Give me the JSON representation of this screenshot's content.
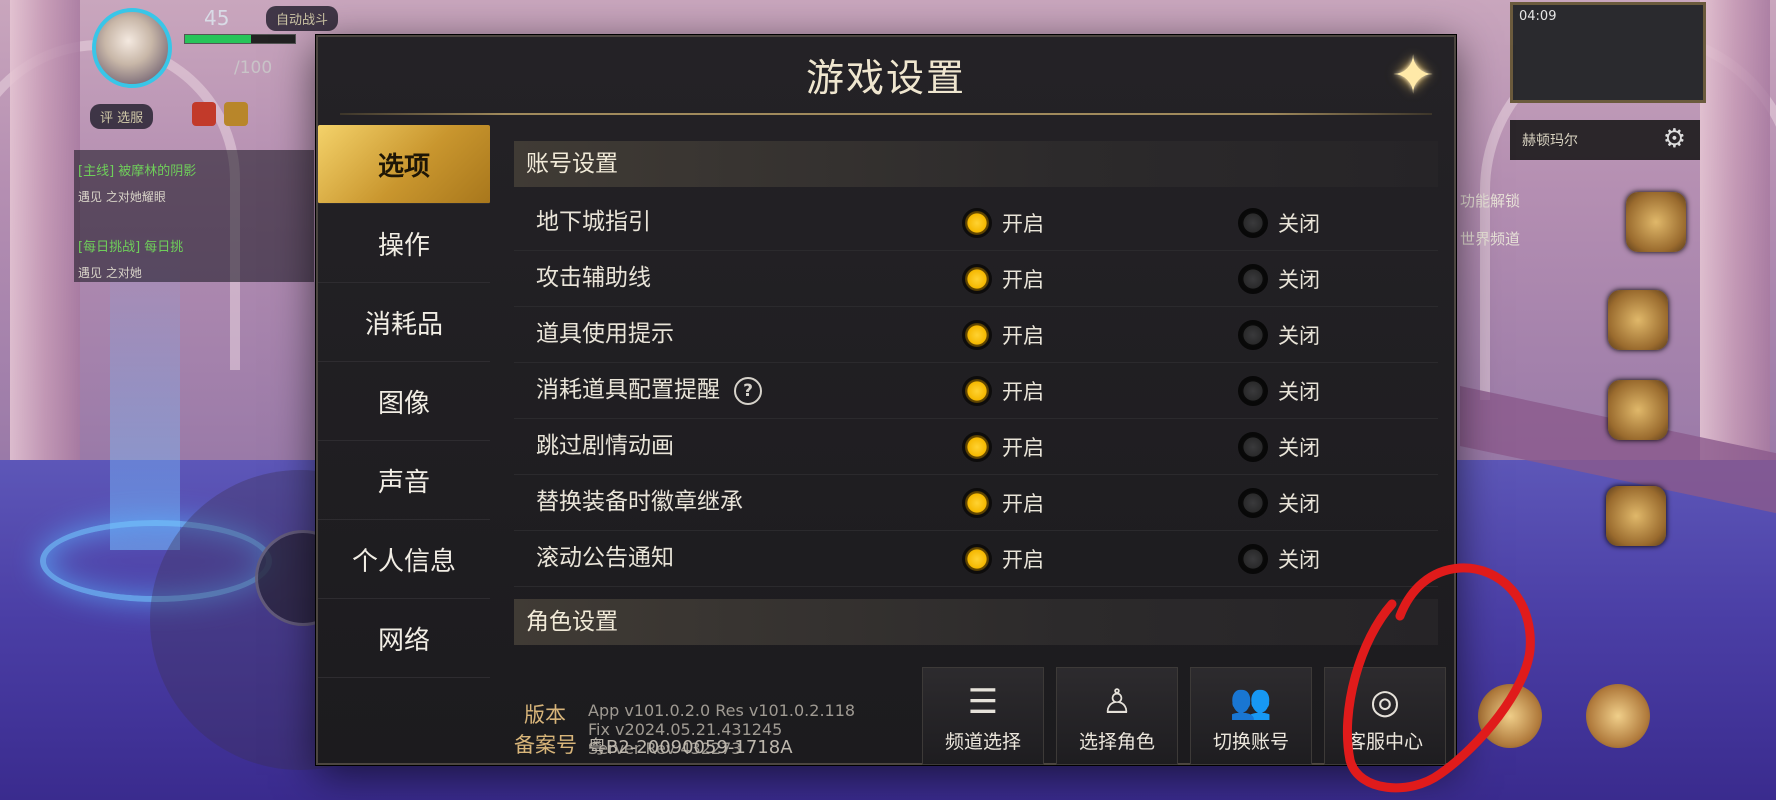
{
  "hud": {
    "level": "45",
    "fatigue": "/100",
    "badge_top": "自动战斗",
    "badge_left": "评 选服",
    "quests": [
      {
        "tag": "[主线]",
        "title": "被摩林的阴影",
        "sub": "遇见 之对她耀眼"
      },
      {
        "tag": "[每日挑战]",
        "title": "每日挑",
        "sub": "遇见 之对她"
      }
    ],
    "map_name": "赫顿玛尔",
    "map_time": "04:09",
    "side_text_1": "功能解锁",
    "side_text_2": "世界频道"
  },
  "dialog": {
    "title": "游戏设置",
    "close_icon": "close-star-icon",
    "tabs": [
      "选项",
      "操作",
      "消耗品",
      "图像",
      "声音",
      "个人信息",
      "网络"
    ],
    "active_tab": "选项",
    "section_account": "账号设置",
    "section_character": "角色设置",
    "on_label": "开启",
    "off_label": "关闭",
    "settings": [
      {
        "label": "地下城指引",
        "value": "开启"
      },
      {
        "label": "攻击辅助线",
        "value": "开启"
      },
      {
        "label": "道具使用提示",
        "value": "开启"
      },
      {
        "label": "消耗道具配置提醒",
        "value": "开启",
        "help": "?"
      },
      {
        "label": "跳过剧情动画",
        "value": "开启"
      },
      {
        "label": "替换装备时徽章继承",
        "value": "开启"
      },
      {
        "label": "滚动公告通知",
        "value": "开启"
      }
    ],
    "version_label": "版本",
    "version_lines": [
      "App v101.0.2.0 Res v101.0.2.118",
      "Fix v2024.05.21.431245",
      "Server Rev 432273"
    ],
    "record_label": "备案号",
    "record_value": "粤B2-20090059-1718A",
    "footer_buttons": [
      {
        "label": "频道选择",
        "icon": "list-icon"
      },
      {
        "label": "选择角色",
        "icon": "character-pin-icon"
      },
      {
        "label": "切换账号",
        "icon": "users-icon"
      },
      {
        "label": "客服中心",
        "icon": "headset-icon"
      }
    ]
  },
  "colors": {
    "accent_gold": "#f5b800",
    "tab_active": "#d9a83e",
    "annotation_red": "#e01b1b"
  }
}
